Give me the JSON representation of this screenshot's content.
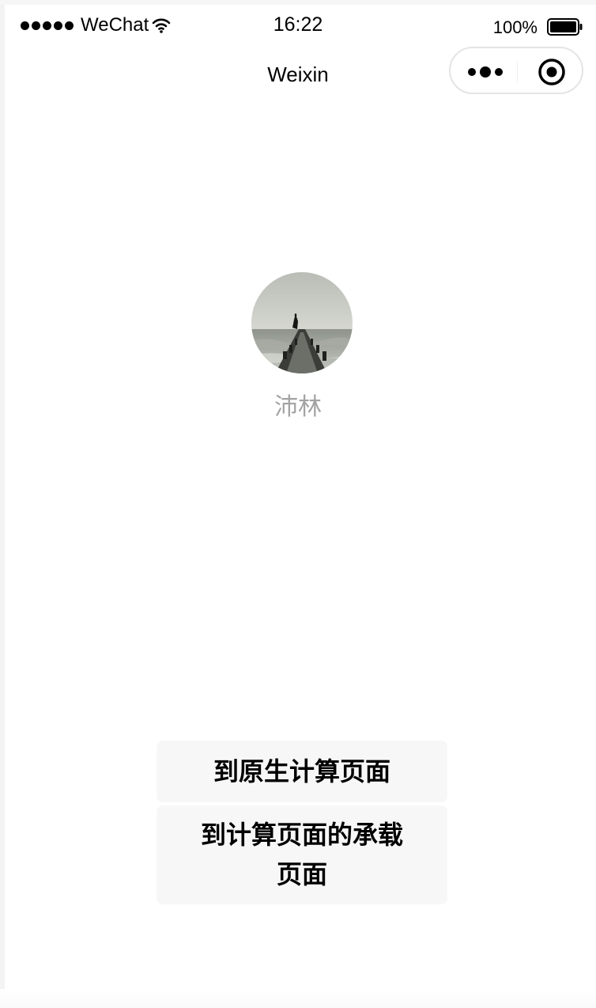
{
  "status_bar": {
    "carrier": "WeChat",
    "time": "16:22",
    "battery_percent": "100%",
    "signal_bars": 5,
    "wifi_icon": "wifi-icon",
    "battery_icon": "battery-icon"
  },
  "nav_bar": {
    "title": "Weixin",
    "more_icon": "more-dots-icon",
    "close_icon": "target-circle-icon"
  },
  "profile": {
    "avatar_icon": "avatar-photo",
    "nickname": "沛林"
  },
  "buttons": {
    "native_compute": "到原生计算页面",
    "compute_host": "到计算页面的承载页面"
  },
  "colors": {
    "button_bg": "#f7f7f7",
    "nickname": "#a3a3a3",
    "capsule_border": "#e4e4e4"
  }
}
